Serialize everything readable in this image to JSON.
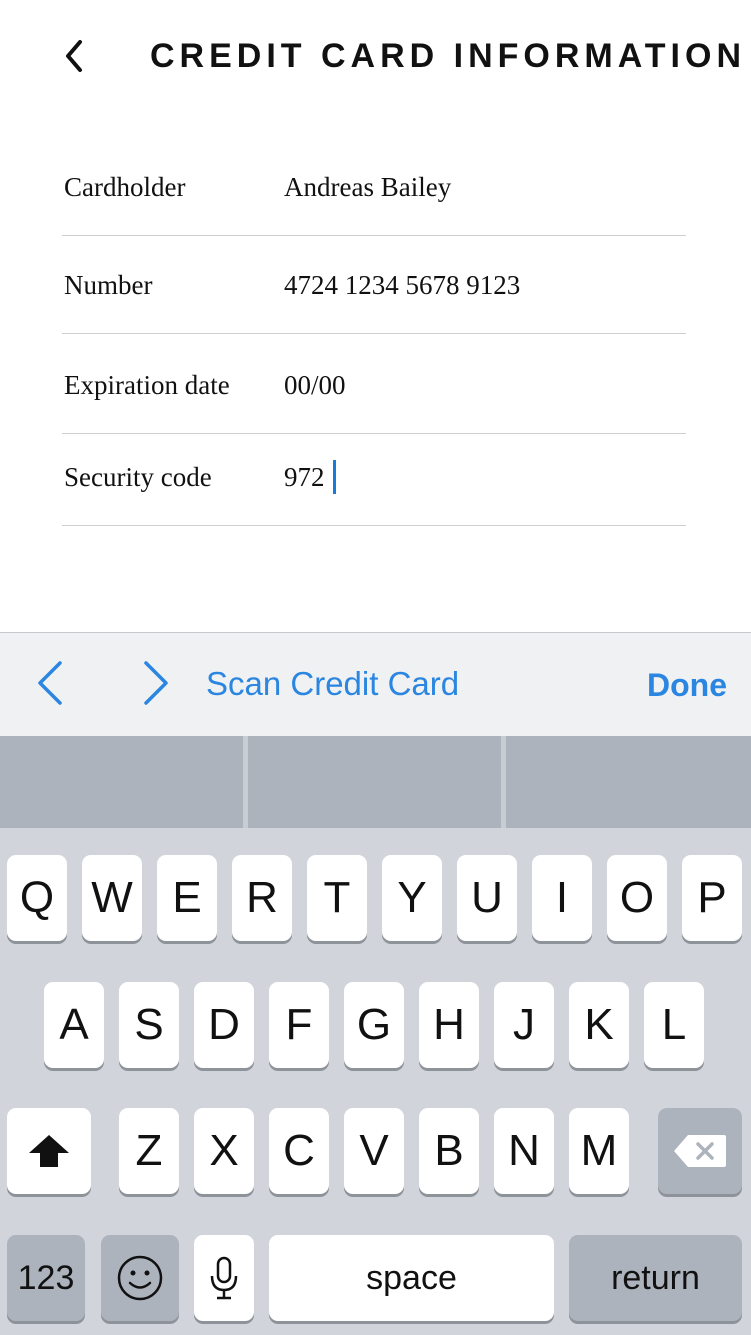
{
  "header": {
    "title": "CREDIT CARD INFORMATION",
    "back_icon": "chevron-left-icon"
  },
  "form": {
    "fields": [
      {
        "label": "Cardholder",
        "value": "Andreas Bailey"
      },
      {
        "label": "Number",
        "value": "4724 1234 5678 9123"
      },
      {
        "label": "Expiration date",
        "value": "00/00"
      },
      {
        "label": "Security code",
        "value": "972"
      }
    ]
  },
  "accessory_bar": {
    "prev_icon": "chevron-left-icon",
    "next_icon": "chevron-right-icon",
    "scan_label": "Scan Credit Card",
    "done_label": "Done",
    "accent_color": "#2a86e0"
  },
  "keyboard": {
    "row1": [
      "Q",
      "W",
      "E",
      "R",
      "T",
      "Y",
      "U",
      "I",
      "O",
      "P"
    ],
    "row2": [
      "A",
      "S",
      "D",
      "F",
      "G",
      "H",
      "J",
      "K",
      "L"
    ],
    "row3": [
      "Z",
      "X",
      "C",
      "V",
      "B",
      "N",
      "M"
    ],
    "shift_icon": "shift-arrow-icon",
    "delete_icon": "backspace-icon",
    "numbers_label": "123",
    "emoji_icon": "smiley-icon",
    "mic_icon": "microphone-icon",
    "space_label": "space",
    "return_label": "return"
  }
}
